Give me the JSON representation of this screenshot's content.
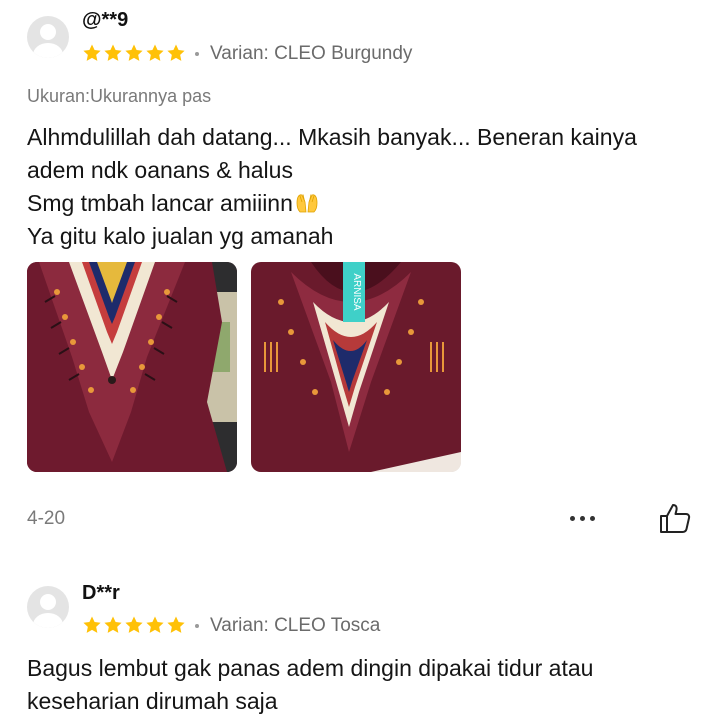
{
  "reviews": [
    {
      "username": "@**9",
      "rating": 5,
      "variant": "Varian: CLEO Burgundy",
      "size_note": "Ukuran:Ukurannya pas",
      "lines": [
        "Alhmdulillah dah datang... Mkasih banyak... Beneran kainya",
        "adem ndk oanans & halus",
        "Smg tmbah lancar amiiinn",
        "Ya gitu kalo jualan yg amanah"
      ],
      "emoji": "palms-up-together-emoji",
      "photos": [
        "photo-burgundy-dress-flat",
        "photo-burgundy-dress-with-tag"
      ],
      "tag_text": "ARNISA",
      "date": "4-20"
    },
    {
      "username": "D**r",
      "rating": 5,
      "variant": "Varian: CLEO Tosca",
      "lines": [
        "Bagus lembut gak panas adem dingin dipakai tidur atau",
        "keseharian dirumah saja"
      ]
    }
  ],
  "icons": {
    "avatar": "default-user-avatar-icon",
    "star": "star-icon",
    "more": "more-options-icon",
    "like": "thumbs-up-icon"
  },
  "colors": {
    "star": "#ffc107",
    "muted_text": "#6b6b6b",
    "dress_burgundy": "#6e1a2e",
    "tag_tosca": "#3fd0c8"
  }
}
